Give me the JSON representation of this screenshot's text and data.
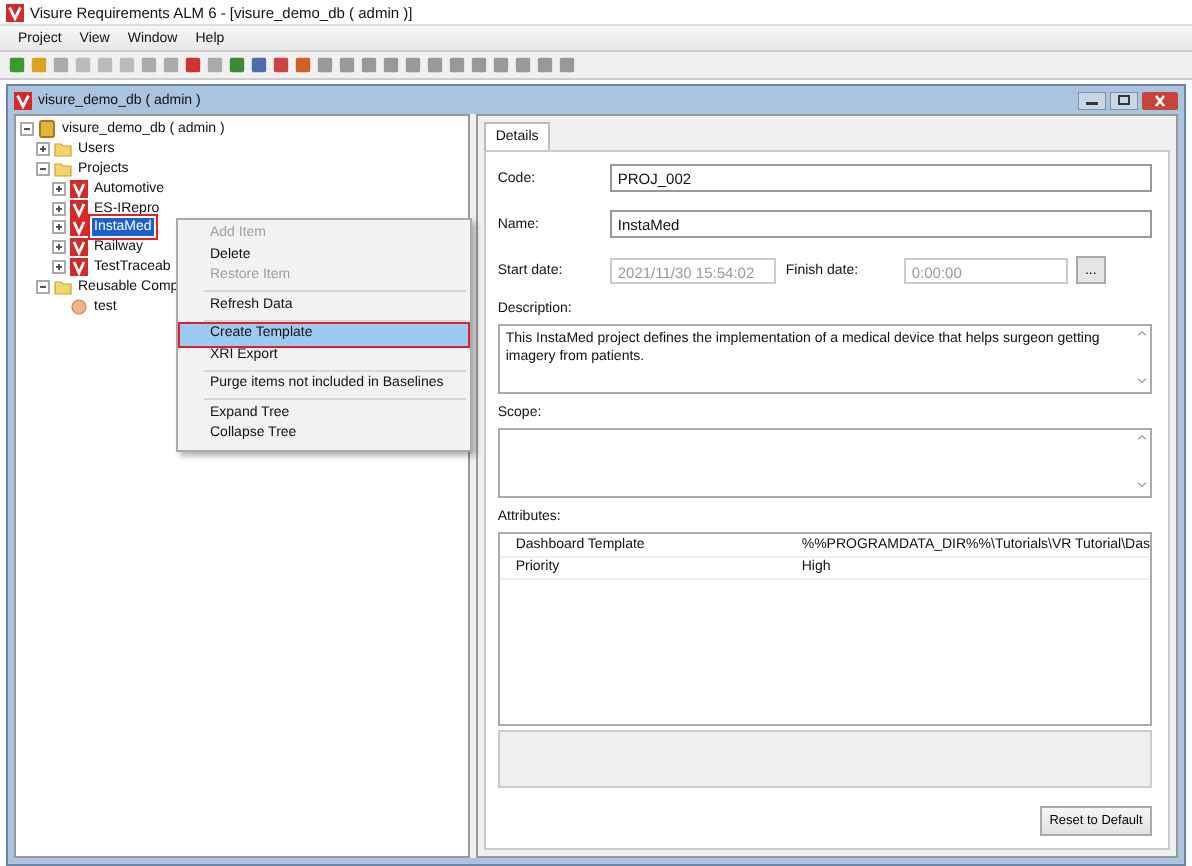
{
  "app_title": "Visure Requirements ALM 6 - [visure_demo_db ( admin )]",
  "menu": [
    "Project",
    "View",
    "Window",
    "Help"
  ],
  "child_window": {
    "title": "visure_demo_db ( admin )"
  },
  "tree": [
    {
      "label": "visure_demo_db ( admin )",
      "kind": "database",
      "expanded": true,
      "selected": false,
      "children": [
        {
          "label": "Users",
          "kind": "folder",
          "expanded": false,
          "selected": false
        },
        {
          "label": "Projects",
          "kind": "folder",
          "expanded": true,
          "selected": false,
          "children": [
            {
              "label": "Automotive",
              "kind": "project",
              "expanded": false,
              "selected": false
            },
            {
              "label": "ES-IRepro",
              "kind": "project",
              "expanded": false,
              "selected": false
            },
            {
              "label": "InstaMed",
              "kind": "project",
              "expanded": false,
              "selected": true
            },
            {
              "label": "Railway",
              "kind": "project",
              "expanded": false,
              "selected": false
            },
            {
              "label": "TestTraceab",
              "kind": "project",
              "expanded": false,
              "selected": false
            }
          ]
        },
        {
          "label": "Reusable Comp",
          "kind": "folder",
          "expanded": true,
          "selected": false,
          "children": [
            {
              "label": "test",
              "kind": "component",
              "selected": false
            }
          ]
        }
      ]
    }
  ],
  "context_menu": {
    "groups": [
      [
        {
          "label": "Add Item",
          "disabled": true,
          "selected": false
        },
        {
          "label": "Delete",
          "disabled": false,
          "selected": false
        },
        {
          "label": "Restore Item",
          "disabled": true,
          "selected": false
        }
      ],
      [
        {
          "label": "Refresh Data",
          "disabled": false,
          "selected": false
        }
      ],
      [
        {
          "label": "Create Template",
          "disabled": false,
          "selected": true
        },
        {
          "label": "XRI Export",
          "disabled": false,
          "selected": false
        }
      ],
      [
        {
          "label": "Purge items not included in Baselines",
          "disabled": false,
          "selected": false
        }
      ],
      [
        {
          "label": "Expand Tree",
          "disabled": false,
          "selected": false
        },
        {
          "label": "Collapse Tree",
          "disabled": false,
          "selected": false
        }
      ]
    ]
  },
  "tabs": [
    {
      "label": "Details",
      "selected": true
    }
  ],
  "form": {
    "code_label": "Code:",
    "code": "PROJ_002",
    "name_label": "Name:",
    "name": "InstaMed",
    "start_label": "Start date:",
    "start": "2021/11/30 15:54:02",
    "finish_label": "Finish date:",
    "finish": "0:00:00",
    "picker_button": "...",
    "description_label": "Description:",
    "description": "This InstaMed project defines the implementation of a medical device that helps surgeon getting imagery from patients.",
    "scope_label": "Scope:",
    "attributes_label": "Attributes:",
    "attributes": [
      {
        "name": "Dashboard Template",
        "value": "%%PROGRAMDATA_DIR%%\\Tutorials\\VR Tutorial\\Das"
      },
      {
        "name": "Priority",
        "value": "High"
      }
    ],
    "reset_button": "Reset to Default"
  }
}
